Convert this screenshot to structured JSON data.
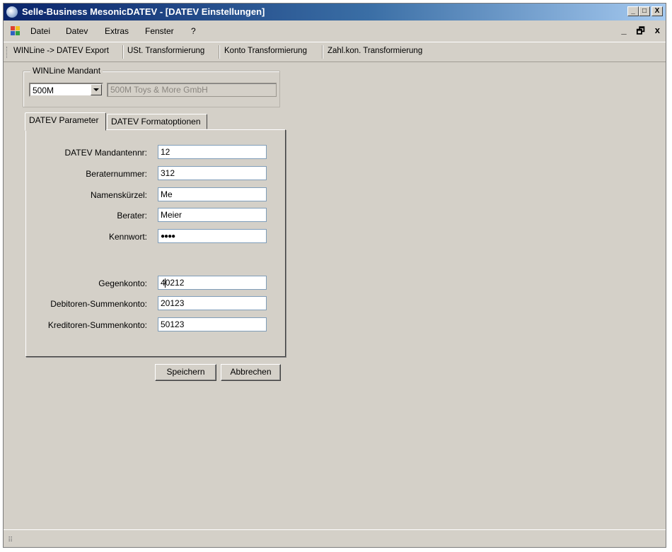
{
  "window": {
    "title": "Selle-Business MesonicDATEV - [DATEV Einstellungen]",
    "title_buttons": [
      "_",
      "□",
      "X"
    ]
  },
  "menubar": {
    "items": [
      "Datei",
      "Datev",
      "Extras",
      "Fenster",
      "?"
    ],
    "mdi_controls": [
      "_",
      "🗗",
      "x"
    ]
  },
  "toolbar": {
    "items": [
      "WINLine -> DATEV Export",
      "USt. Transformierung",
      "Konto Transformierung",
      "Zahl.kon. Transformierung"
    ]
  },
  "mandant_group": {
    "legend": "WINLine Mandant",
    "selected": "500M",
    "name": "500M Toys & More GmbH"
  },
  "tabs": [
    {
      "label": "DATEV Parameter",
      "active": true
    },
    {
      "label": "DATEV Formatoptionen",
      "active": false
    }
  ],
  "fields": {
    "mandantennr": {
      "label": "DATEV Mandantennr:",
      "value": "12"
    },
    "beraternummer": {
      "label": "Beraternummer:",
      "value": "312"
    },
    "namenskuerzel": {
      "label": "Namenskürzel:",
      "value": "Me"
    },
    "berater": {
      "label": "Berater:",
      "value": "Meier"
    },
    "kennwort": {
      "label": "Kennwort:",
      "value": "●●●●"
    },
    "gegenkonto": {
      "label": "Gegenkonto:",
      "value_before_cursor": "4",
      "value_after_cursor": "0212"
    },
    "debitoren": {
      "label": "Debitoren-Summenkonto:",
      "value": "20123"
    },
    "kreditoren": {
      "label": "Kreditoren-Summenkonto:",
      "value": "50123"
    }
  },
  "buttons": {
    "save": "Speichern",
    "cancel": "Abbrechen"
  },
  "statusbar": {
    "grip": "⠿"
  },
  "colors": {
    "window_bg": "#d4d0c8",
    "title_start": "#0a246a",
    "title_end": "#a6caf0"
  }
}
